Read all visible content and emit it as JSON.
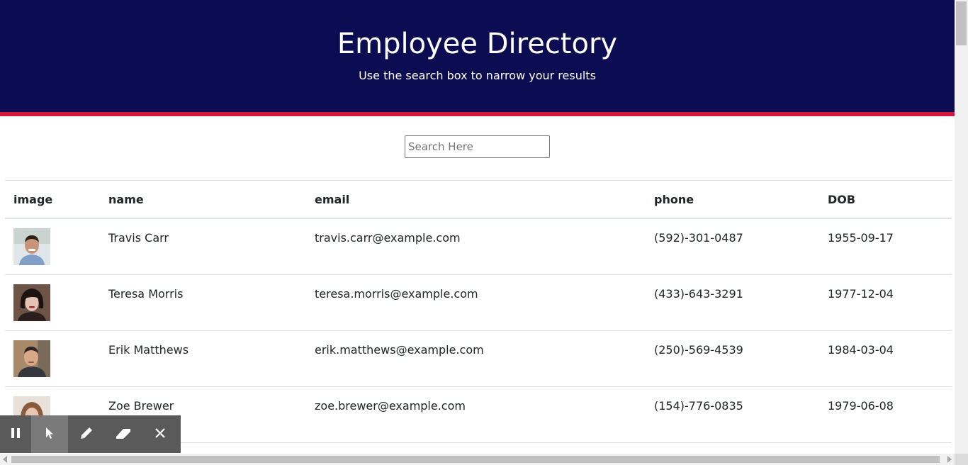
{
  "header": {
    "title": "Employee Directory",
    "subtitle": "Use the search box to narrow your results"
  },
  "search": {
    "placeholder": "Search Here",
    "value": ""
  },
  "table": {
    "columns": [
      "image",
      "name",
      "email",
      "phone",
      "DOB"
    ],
    "rows": [
      {
        "name": "Travis Carr",
        "email": "travis.carr@example.com",
        "phone": "(592)-301-0487",
        "dob": "1955-09-17"
      },
      {
        "name": "Teresa Morris",
        "email": "teresa.morris@example.com",
        "phone": "(433)-643-3291",
        "dob": "1977-12-04"
      },
      {
        "name": "Erik Matthews",
        "email": "erik.matthews@example.com",
        "phone": "(250)-569-4539",
        "dob": "1984-03-04"
      },
      {
        "name": "Zoe Brewer",
        "email": "zoe.brewer@example.com",
        "phone": "(154)-776-0835",
        "dob": "1979-06-08"
      }
    ]
  },
  "toolbar": {
    "tools": [
      "pause-icon",
      "pointer-icon",
      "pencil-icon",
      "eraser-icon",
      "close-icon"
    ],
    "active_tool": "pointer-icon"
  },
  "colors": {
    "header_bg": "#0c0c52",
    "header_accent": "#d6173d",
    "toolbar_bg": "#5a5a5a"
  }
}
